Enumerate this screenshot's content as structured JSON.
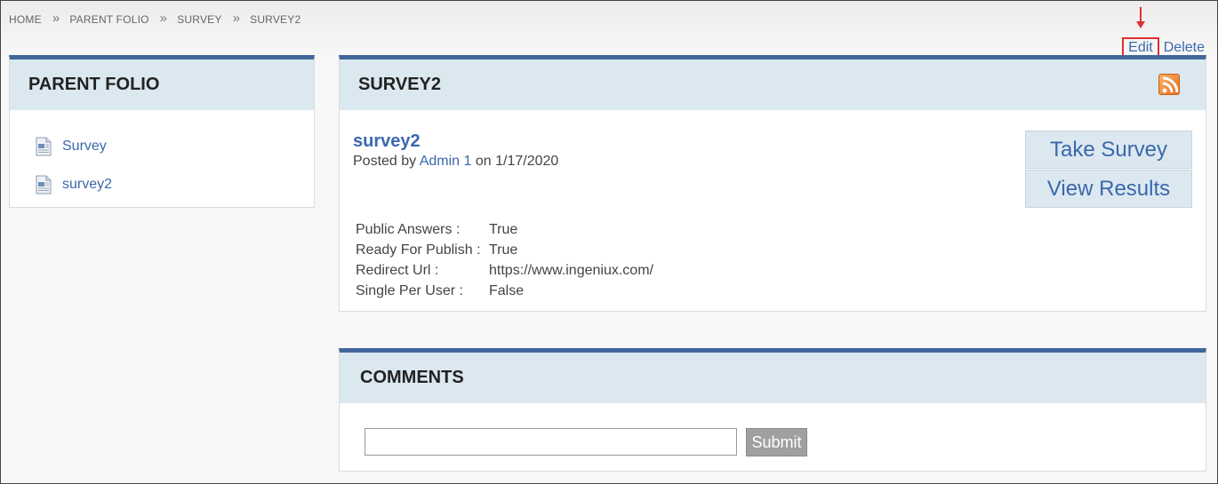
{
  "breadcrumb": {
    "items": [
      "HOME",
      "PARENT FOLIO",
      "SURVEY",
      "SURVEY2"
    ],
    "separator": "»"
  },
  "actions": {
    "edit_label": "Edit",
    "delete_label": "Delete"
  },
  "sidebar": {
    "title": "PARENT FOLIO",
    "items": [
      {
        "label": "Survey",
        "icon": "document-icon"
      },
      {
        "label": "survey2",
        "icon": "document-icon"
      }
    ]
  },
  "main": {
    "title": "SURVEY2",
    "post_title": "survey2",
    "posted_prefix": "Posted by",
    "author": "Admin 1",
    "posted_on": "on 1/17/2020",
    "take_survey_label": "Take Survey",
    "view_results_label": "View Results",
    "properties": [
      {
        "key": "Public Answers :",
        "value": "True"
      },
      {
        "key": "Ready For Publish :",
        "value": "True"
      },
      {
        "key": "Redirect Url :",
        "value": "https://www.ingeniux.com/"
      },
      {
        "key": "Single Per User :",
        "value": "False"
      }
    ]
  },
  "comments": {
    "title": "COMMENTS",
    "input_value": "",
    "submit_label": "Submit"
  },
  "colors": {
    "accent_bar": "#41679c",
    "header_bg": "#dce8f0",
    "link": "#3a68ad",
    "highlight": "#e03030"
  }
}
